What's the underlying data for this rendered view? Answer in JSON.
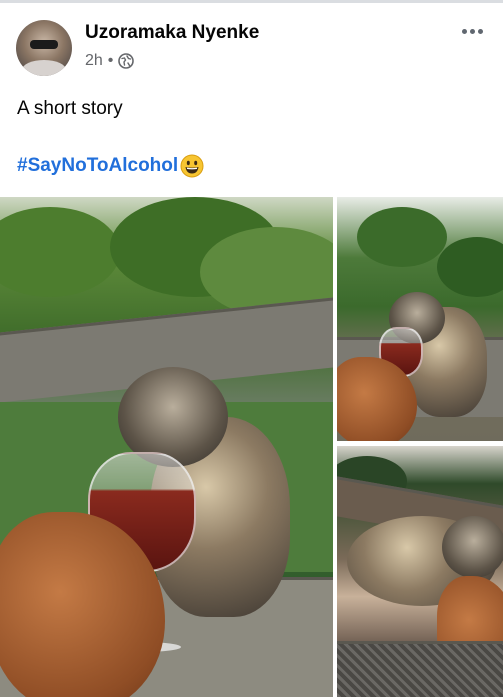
{
  "post": {
    "author_name": "Uzoramaka Nyenke",
    "time_ago": "2h",
    "separator": "•",
    "privacy_icon": "globe-icon",
    "body_text": "A short story",
    "hashtag": "#SayNoToAlcohol",
    "emoji": "grinning-face-emoji"
  },
  "header": {
    "more_icon": "more-options-icon"
  },
  "photos": [
    {
      "name": "photo-main",
      "description_icon": "monkey-drinking-wine"
    },
    {
      "name": "photo-top-right",
      "description_icon": "monkey-with-glass"
    },
    {
      "name": "photo-bottom-right",
      "description_icon": "monkey-lying-down"
    }
  ],
  "colors": {
    "name_text": "#050505",
    "meta_text": "#65676b",
    "hashtag": "#216fdb",
    "divider": "#dadde1"
  }
}
